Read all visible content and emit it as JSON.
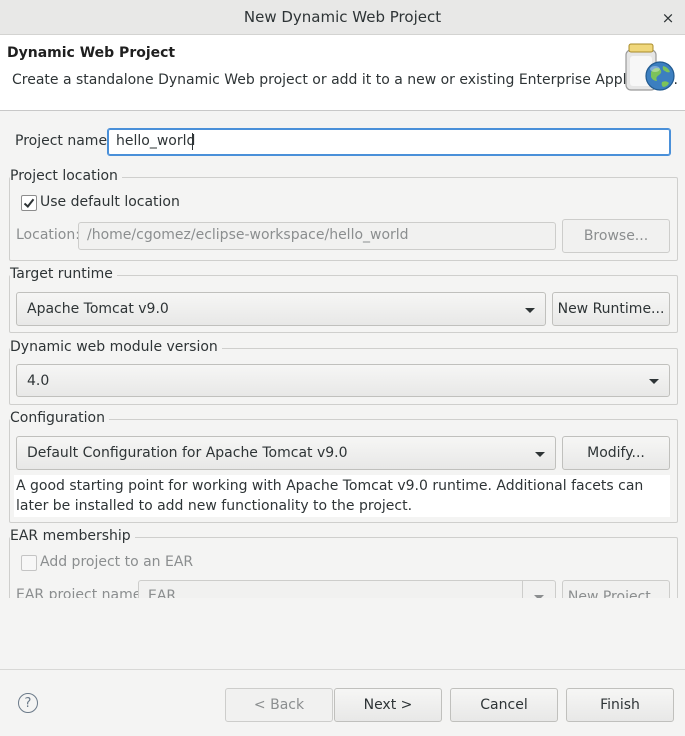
{
  "window": {
    "title": "New Dynamic Web Project",
    "close_glyph": "×"
  },
  "header": {
    "title": "Dynamic Web Project",
    "description": "Create a standalone Dynamic Web project or add it to a new or existing Enterprise Application."
  },
  "project_name": {
    "label": "Project name:",
    "value": "hello_world"
  },
  "project_location": {
    "group_label": "Project location",
    "use_default_label": "Use default location",
    "use_default_checked": true,
    "location_label": "Location:",
    "location_value": "/home/cgomez/eclipse-workspace/hello_world",
    "browse_label": "Browse..."
  },
  "target_runtime": {
    "group_label": "Target runtime",
    "selected": "Apache Tomcat v9.0",
    "new_runtime_label": "New Runtime..."
  },
  "module_version": {
    "group_label": "Dynamic web module version",
    "selected": "4.0"
  },
  "configuration": {
    "group_label": "Configuration",
    "selected": "Default Configuration for Apache Tomcat v9.0",
    "modify_label": "Modify...",
    "description": "A good starting point for working with Apache Tomcat v9.0 runtime. Additional facets can later be installed to add new functionality to the project."
  },
  "ear": {
    "group_label": "EAR membership",
    "add_label": "Add project to an EAR",
    "add_checked": false,
    "name_label": "EAR project name:",
    "name_value": "EAR",
    "new_project_label": "New Project..."
  },
  "footer": {
    "help_glyph": "?",
    "back_label": "< Back",
    "next_label": "Next >",
    "cancel_label": "Cancel",
    "finish_label": "Finish"
  },
  "colors": {
    "focus": "#4a90d9",
    "background": "#f4f4f3",
    "banner": "#ffffff"
  },
  "icons": [
    "close-icon",
    "wizard-globe-icon",
    "checkmark-icon",
    "dropdown-caret-icon",
    "help-icon"
  ]
}
